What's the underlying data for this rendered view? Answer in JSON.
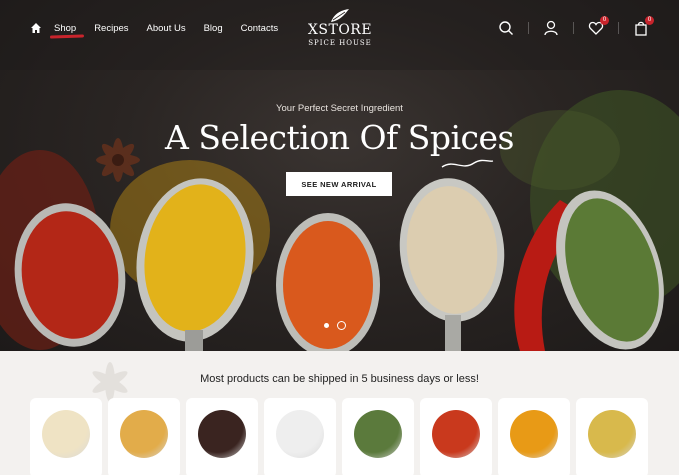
{
  "nav": {
    "links": [
      "Shop",
      "Recipes",
      "About Us",
      "Blog",
      "Contacts"
    ],
    "active": "Shop",
    "wishlist_count": "0",
    "cart_count": "0"
  },
  "logo": {
    "brand": "XSTORE",
    "tagline": "SPICE HOUSE"
  },
  "hero": {
    "eyebrow": "Your Perfect Secret Ingredient",
    "headline": "A Selection Of Spices",
    "cta": "SEE NEW ARRIVAL",
    "slides": 2,
    "active_slide": 2
  },
  "notice": "Most products can be shipped in 5 business days or less!",
  "colors": {
    "accent": "#c8242c",
    "hero_bg": "#2a2523",
    "page_bg": "#f3f1ef"
  },
  "products": [
    {
      "name": "garlic-granules",
      "color": "#efe3c4"
    },
    {
      "name": "ground-ginger",
      "color": "#e2ac4a"
    },
    {
      "name": "black-peppercorns",
      "color": "#3a2420"
    },
    {
      "name": "sea-salt",
      "color": "#eeeeee"
    },
    {
      "name": "dried-herbs",
      "color": "#5b7a3c"
    },
    {
      "name": "paprika",
      "color": "#c9391d"
    },
    {
      "name": "turmeric",
      "color": "#e89a16"
    },
    {
      "name": "mustard-powder",
      "color": "#d8b94c"
    }
  ]
}
